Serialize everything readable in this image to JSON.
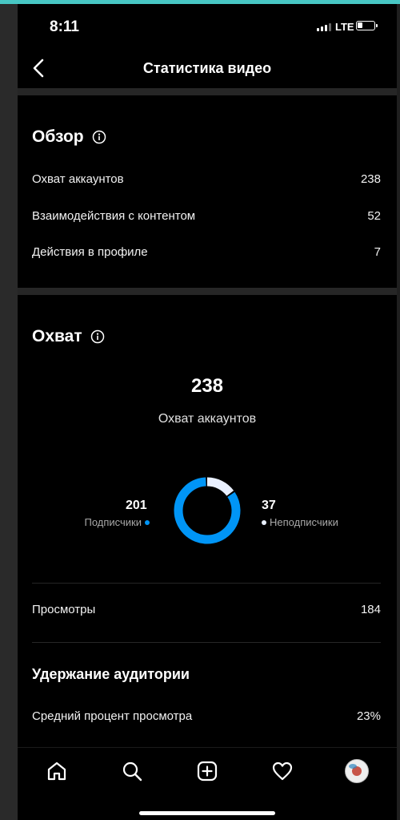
{
  "status": {
    "time": "8:11",
    "network": "LTE"
  },
  "nav": {
    "title": "Статистика видео"
  },
  "overview": {
    "title": "Обзор",
    "rows": [
      {
        "label": "Охват аккаунтов",
        "value": "238"
      },
      {
        "label": "Взаимодействия с контентом",
        "value": "52"
      },
      {
        "label": "Действия в профиле",
        "value": "7"
      }
    ]
  },
  "reach": {
    "title": "Охват",
    "total": "238",
    "total_label": "Охват аккаунтов",
    "followers": {
      "value": "201",
      "label": "Подписчики",
      "count": 201,
      "color": "#0095f6"
    },
    "non_followers": {
      "value": "37",
      "label": "Неподписчики",
      "count": 37,
      "color": "#e9f0ff"
    },
    "views": {
      "label": "Просмотры",
      "value": "184"
    }
  },
  "retention": {
    "title": "Удержание аудитории",
    "avg_watch": {
      "label": "Средний процент просмотра",
      "value": "23%"
    }
  },
  "tabs": [
    "home-icon",
    "search-icon",
    "create-icon",
    "heart-icon",
    "profile-avatar"
  ],
  "colors": {
    "accent": "#0095f6",
    "background": "#000000",
    "divider": "#262626"
  }
}
